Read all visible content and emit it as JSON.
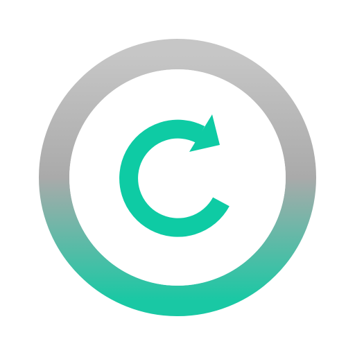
{
  "icon": {
    "name": "refresh-icon",
    "colors": {
      "background": "#ffffff",
      "ring_top": "#c6c6c6",
      "ring_mid": "#aaaaaa",
      "ring_bottom": "#19c8a4",
      "arrow": "#0ecba4"
    }
  }
}
